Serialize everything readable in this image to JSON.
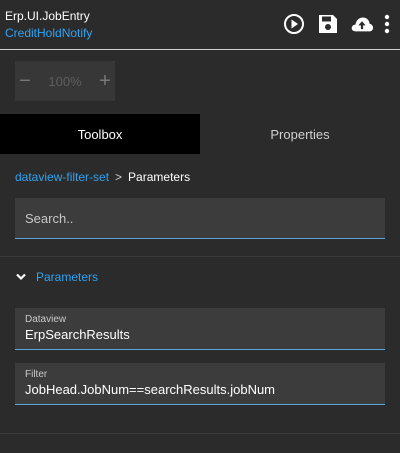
{
  "header": {
    "title": "Erp.UI.JobEntry",
    "subtitle": "CreditHoldNotify",
    "icons": [
      "play-circle-icon",
      "save-icon",
      "cloud-upload-icon",
      "more-vertical-icon"
    ]
  },
  "zoom": {
    "minus": "−",
    "value": "100%",
    "plus": "+"
  },
  "tabs": [
    {
      "label": "Toolbox",
      "active": true
    },
    {
      "label": "Properties",
      "active": false
    }
  ],
  "breadcrumb": {
    "parent": "dataview-filter-set",
    "separator": ">",
    "current": "Parameters"
  },
  "search": {
    "placeholder": "Search.."
  },
  "section": {
    "label": "Parameters",
    "expanded": true
  },
  "fields": [
    {
      "label": "Dataview",
      "value": "ErpSearchResults"
    },
    {
      "label": "Filter",
      "value": "JobHead.JobNum==searchResults.jobNum"
    }
  ],
  "colors": {
    "accent": "#2ea3f2",
    "background": "#2b2b2b",
    "field_bg": "#3c3c3c",
    "active_tab": "#000000"
  }
}
